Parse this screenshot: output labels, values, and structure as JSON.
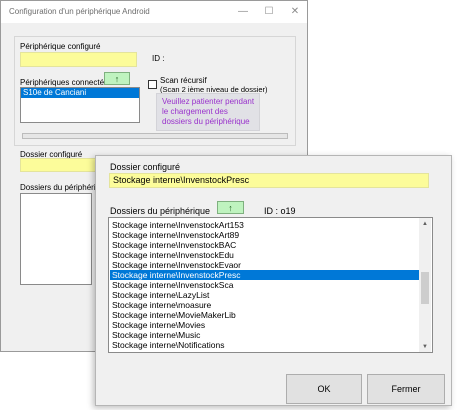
{
  "background_window": {
    "title": "Configuration d'un périphérique Android",
    "controls": {
      "minimize": "—",
      "maximize": "☐",
      "close": "✕"
    },
    "peripheral_configured_label": "Périphérique configuré",
    "id_label": "ID :",
    "connected_label": "Périphériques connectés",
    "up_button": "↑",
    "connected_devices": [
      "S10e de Canciani"
    ],
    "scan_recursive_label": "Scan récursif",
    "scan_recursive_hint": "(Scan 2 ième niveau de dossier)",
    "waiting_message": "Veuillez patienter pendant le chargement des dossiers du périphérique",
    "folder_configured_label": "Dossier configuré",
    "device_folders_label": "Dossiers du périphérique"
  },
  "dialog": {
    "folder_configured_label": "Dossier configuré",
    "folder_configured_value": "Stockage interne\\InvenstockPresc",
    "device_folders_label": "Dossiers du périphérique",
    "up_button": "↑",
    "id_text": "ID : o19",
    "folders": [
      "Stockage interne\\InvenstockArt153",
      "Stockage interne\\InvenstockArt89",
      "Stockage interne\\InvenstockBAC",
      "Stockage interne\\InvenstockEdu",
      "Stockage interne\\InvenstockEvaor",
      "Stockage interne\\InvenstockPresc",
      "Stockage interne\\InvenstockSca",
      "Stockage interne\\LazyList",
      "Stockage interne\\moasure",
      "Stockage interne\\MovieMakerLib",
      "Stockage interne\\Movies",
      "Stockage interne\\Music",
      "Stockage interne\\Notifications"
    ],
    "selected_index": 5,
    "ok_label": "OK",
    "close_label": "Fermer"
  },
  "colors": {
    "selection": "#0078d7",
    "field_yellow": "#fcfc9a",
    "button_green": "#bff3bf",
    "waiting_text": "#9932cc"
  }
}
